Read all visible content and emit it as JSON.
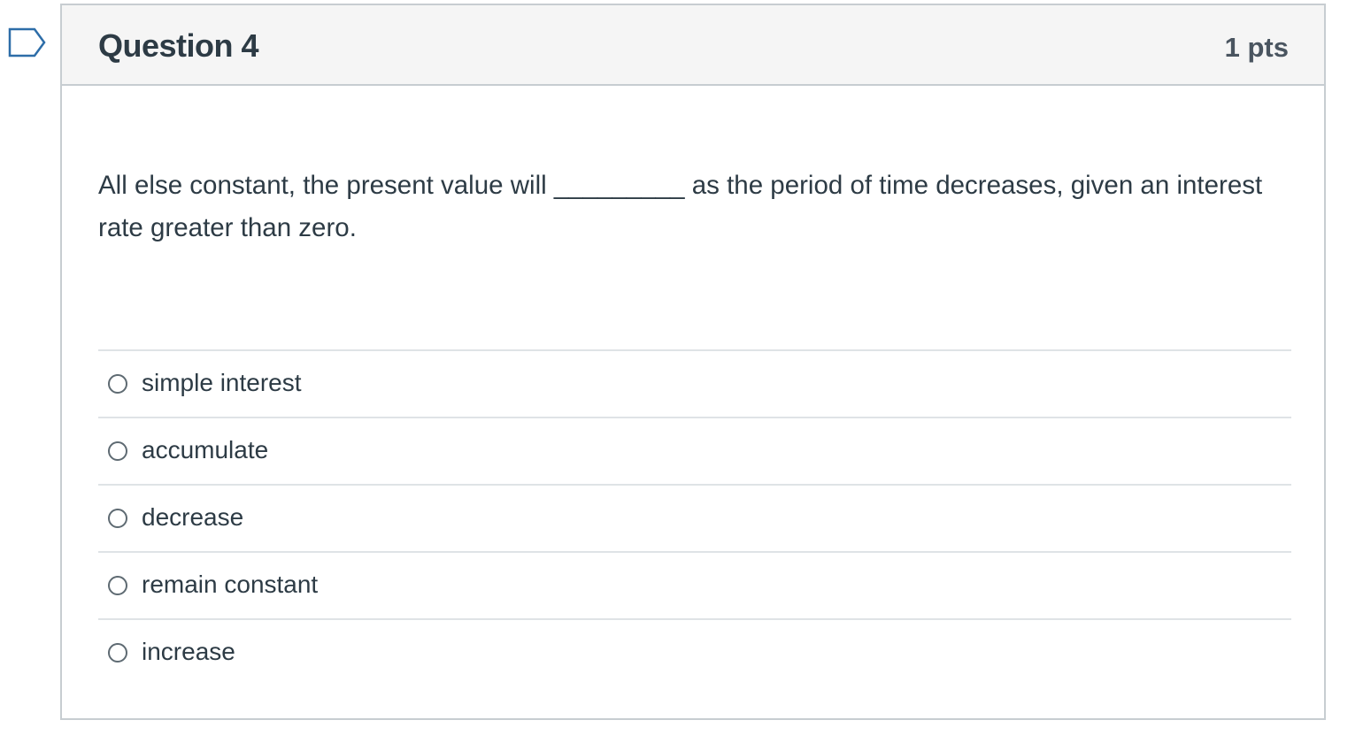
{
  "question": {
    "title": "Question 4",
    "points": "1 pts",
    "text": "All else constant, the present value will _________ as the period of time decreases, given an interest rate greater than zero."
  },
  "flag": {
    "icon": "flag-icon",
    "color": "#2d6da8"
  },
  "answers": [
    {
      "label": "simple interest",
      "selected": false
    },
    {
      "label": "accumulate",
      "selected": false
    },
    {
      "label": "decrease",
      "selected": false
    },
    {
      "label": "remain constant",
      "selected": false
    },
    {
      "label": "increase",
      "selected": false
    }
  ]
}
